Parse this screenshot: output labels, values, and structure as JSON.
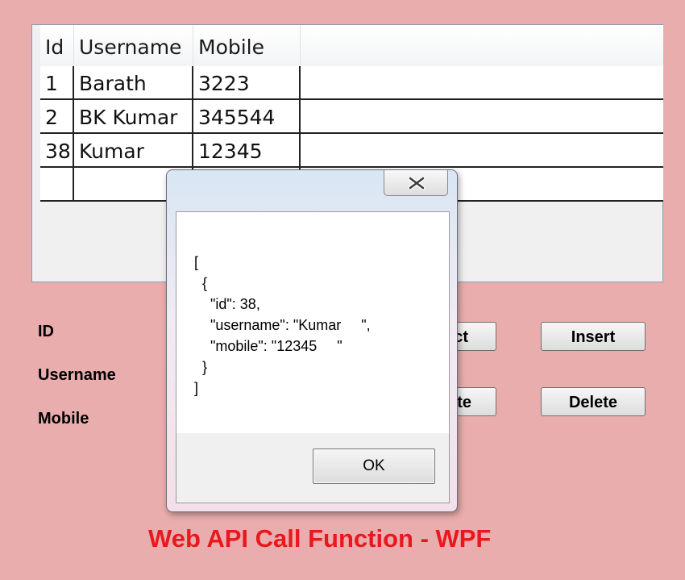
{
  "grid": {
    "columns": [
      "Id",
      "Username",
      "Mobile"
    ],
    "rows": [
      {
        "id": "1",
        "username": "Barath",
        "mobile": "3223"
      },
      {
        "id": "2",
        "username": "BK Kumar",
        "mobile": "345544"
      },
      {
        "id": "38",
        "username": "Kumar",
        "mobile": "12345"
      },
      {
        "id": "",
        "username": "",
        "mobile": ""
      }
    ]
  },
  "form": {
    "id_label": "ID",
    "username_label": "Username",
    "mobile_label": "Mobile"
  },
  "buttons": {
    "select_partial": "ct",
    "update_partial": "te",
    "insert": "Insert",
    "delete": "Delete"
  },
  "message_box": {
    "text": "[\n  {\n    \"id\": 38,\n    \"username\": \"Kumar     \",\n    \"mobile\": \"12345     \"\n  }\n]",
    "ok_label": "OK"
  },
  "footer_title": "Web API Call Function - WPF",
  "colors": {
    "background": "#e9adad",
    "title": "#e8181e"
  }
}
